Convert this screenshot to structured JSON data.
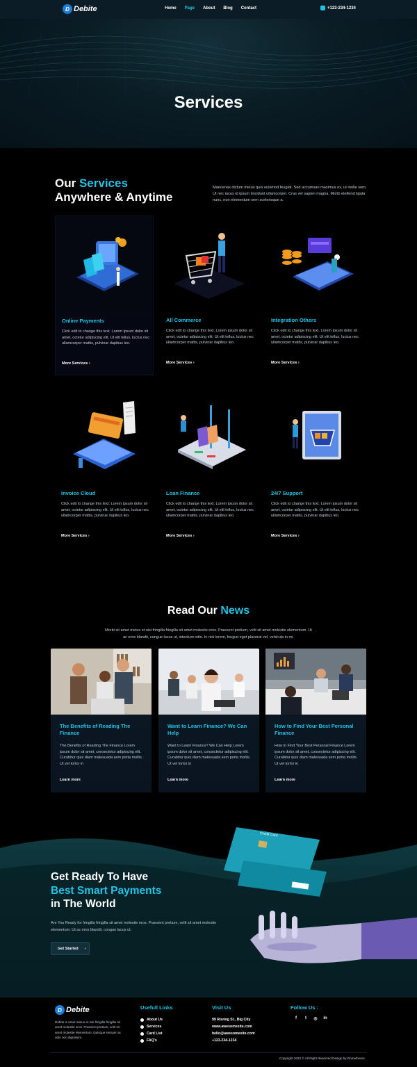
{
  "nav": {
    "brand": "Debite",
    "brand_mark": "D",
    "items": [
      {
        "label": "Home",
        "active": false
      },
      {
        "label": "Page",
        "active": true
      },
      {
        "label": "About",
        "active": false
      },
      {
        "label": "Blog",
        "active": false
      },
      {
        "label": "Contact",
        "active": false
      }
    ],
    "phone": "+123-234-1234",
    "phone_icon": "phone-icon"
  },
  "hero": {
    "title": "Services"
  },
  "services": {
    "heading_part1": "Our ",
    "heading_highlight": "Services",
    "heading_line2": "Anywhere & Anytime",
    "description": "Maecenas dictum metus quis eulsmod feugiat. Sed accumsan maximus ex, ut molle sem. Ut nec iacus id ipsum tincidunt ullamcorper. Cras vel sapien magna. Morbi eleifend ligula nunc, non elementum sem scelerisque a.",
    "items": [
      {
        "title": "Online Payments",
        "text": "Click edit to change this text. Lorem ipsum dolor sit amet, octetur adipiscing elit. Ut elit tellus, luctus nec ullamcorper mattis, pulvinar dapibus leo.",
        "more": "More Services ›"
      },
      {
        "title": "All Commerce",
        "text": "Click edit to change this text. Lorem ipsum dolor sit amet, octetur adipiscing elit. Ut elit tellus, luctus nec ullamcorper mattis, pulvinar dapibus leo.",
        "more": "More Services ›"
      },
      {
        "title": "Integration Others",
        "text": "Click edit to change this text. Lorem ipsum dolor sit amet, octetur adipiscing elit. Ut elit tellus, luctus nec ullamcorper mattis, pulvinar dapibus leo.",
        "more": "More Services ›"
      },
      {
        "title": "Invoice Cloud",
        "text": "Click edit to change this text. Lorem ipsum dolor sit amet, octetur adipiscing elit. Ut elit tellus, luctus nec ullamcorper mattis, pulvinar dapibus leo.",
        "more": "More Services ›"
      },
      {
        "title": "Loan Finance",
        "text": "Click edit to change this text. Lorem ipsum dolor sit amet, octetur adipiscing elit. Ut elit tellus, luctus nec ullamcorper mattis, pulvinar dapibus leo.",
        "more": "More Services ›"
      },
      {
        "title": "24/7 Support",
        "text": "Click edit to change this text. Lorem ipsum dolor sit amet, octetur adipiscing elit. Ut elit tellus, luctus nec ullamcorper mattis, pulvinar dapibus leo.",
        "more": "More Services ›"
      }
    ]
  },
  "news": {
    "heading_part1": "Read Our ",
    "heading_highlight": "News",
    "description": "Morbi sit amet metus et nisi fringilla fringilla sit amet molestie eros. Praesent pretium, velit sit amet molestie elementum.  Ut ac eros blandit, congue lacus ut, interdum odio. In nisi lorem, feugiat eget placerat vel, vehicula in mi.",
    "items": [
      {
        "title": "The Benefits of Reading The Finance",
        "text": "The Benefits of Reading The Finance Lorem ipsum dolor sit amet, consectetur adipiscing elit. Curabitur quis diam malesuada sem porta mollis. Ut vel tortor in",
        "more": "Learn more"
      },
      {
        "title": "Want to Learn Finance? We Can Help",
        "text": "Want to Learn Finance? We Can Help Lorem ipsum dolor sit amet, consectetur adipiscing elit. Curabitur quis diam malesuada sem porta mollis. Ut vel tortor in",
        "more": "Learn more"
      },
      {
        "title": "How to Find Your Best Personal Finance",
        "text": "How to Find Your Best Personal Finance Lorem ipsum dolor sit amet, consectetur adipiscing elit. Curabitur quis diam malesuada sem porta mollis. Ut vel tortor in",
        "more": "Learn more"
      }
    ]
  },
  "cta": {
    "line1": "Get Ready To Have",
    "line2": "Best Smart Payments",
    "line3": "in The World",
    "description": "Are You Ready for fringilla fringilla sit amet molestie eros. Praesent pretium, velit sit amet molestie elementum.  Ut ac eros blandit, congue lacus ut.",
    "button": "Get Started",
    "button_arrow": "›",
    "card_label": "Credit Card"
  },
  "footer": {
    "brand": "Debite",
    "brand_mark": "D",
    "description": "Debite is amet metus et nisi fringilla fringilla sit amet molestie eros. Praesent pretium, velit sit amet molestie elementum. Quisque semper ac odio non dignissim.",
    "links_heading": "Usefull Links",
    "links": [
      "About Us",
      "Services",
      "Card List",
      "FAQ's"
    ],
    "visit_heading": "Visit Us",
    "visit": [
      "99 Roving St., Big City",
      "www.awesomesite.com",
      "hello@awesomesite.com",
      "+123-234-1234"
    ],
    "follow_heading": "Follow Us :",
    "social": [
      {
        "icon": "facebook-icon",
        "glyph": "f"
      },
      {
        "icon": "twitter-icon",
        "glyph": "t"
      },
      {
        "icon": "instagram-icon",
        "glyph": "◎"
      },
      {
        "icon": "linkedin-icon",
        "glyph": "in"
      }
    ],
    "copyright": "Copyright 2022 © All Right Reserved Design by Rometheme"
  },
  "colors": {
    "accent": "#22c3e6",
    "background": "#000000",
    "card": "#0c1a26"
  }
}
